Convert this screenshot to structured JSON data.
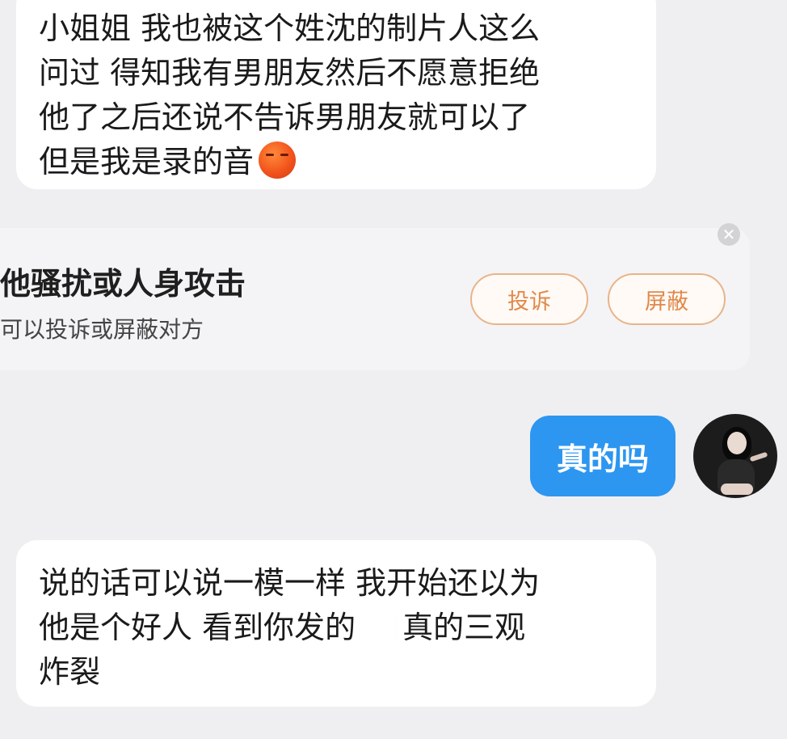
{
  "messages": [
    {
      "direction": "incoming",
      "lines": [
        "小姐姐 我也被这个姓沈的制片人这么",
        "问过 得知我有男朋友然后不愿意拒绝",
        "他了之后还说不告诉男朋友就可以了",
        "但是我是录的音"
      ],
      "emoji": "orange-face-emoji"
    },
    {
      "direction": "outgoing",
      "text": "真的吗"
    },
    {
      "direction": "incoming",
      "lines": [
        "说的话可以说一模一样 我开始还以为",
        "他是个好人 看到你发的",
        "真的三观",
        "炸裂"
      ]
    }
  ],
  "harassment_prompt": {
    "title": "他骚扰或人身攻击",
    "subtitle": "可以投诉或屏蔽对方",
    "report_label": "投诉",
    "block_label": "屏蔽",
    "close_icon": "close-icon",
    "accent_color": "#e0894c"
  },
  "colors": {
    "outgoing_bubble": "#2d96f0",
    "incoming_bubble": "#ffffff",
    "background": "#efeff2"
  }
}
